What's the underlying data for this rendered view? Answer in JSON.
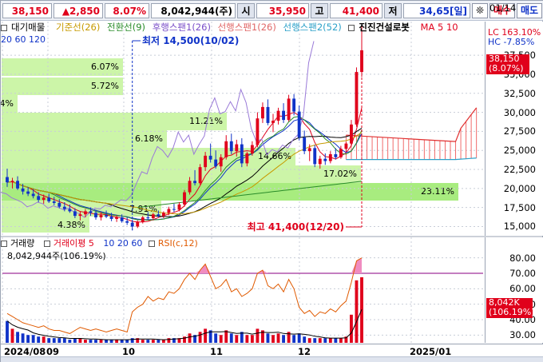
{
  "quote": {
    "price": "38,150",
    "change": "▲2,850",
    "change_pct": "8.07%",
    "volume": "8,042,944(주)",
    "open_label": "시",
    "open": "35,950",
    "high_label": "고",
    "high": "41,400",
    "low_label": "저",
    "low_value": "34,65[일]",
    "buy_label": "매수",
    "sell_label": "매도"
  },
  "legend": {
    "sections": "대기매물",
    "base_line": "기준선(26)",
    "conversion_line": "전환선(9)",
    "lagging_span": "후행스팬1(26)",
    "leading_span1": "선행스팬1(26)",
    "leading_span2": "선행스팬2(52)",
    "robot": "진진건설로봇",
    "ma_label": "MA 5  10",
    "ma_periods": "20  60  120"
  },
  "annotations": {
    "low_marker": "최저 14,500(10/02)",
    "high_marker": "최고 41,400(12/20)"
  },
  "supply_zones": [
    {
      "label": "6.07%"
    },
    {
      "label": "5.72%"
    },
    {
      "label": "0.94%"
    },
    {
      "label": "11.21%"
    },
    {
      "label": "6.18%"
    },
    {
      "label": "14.66%"
    },
    {
      "label": "17.02%"
    },
    {
      "label": "23.11%"
    },
    {
      "label": "7.91%"
    },
    {
      "label": "4.38%"
    }
  ],
  "price_axis": {
    "lc": "LC 163.10%",
    "hc": "HC  -7.85%",
    "current_price": "38,150",
    "current_pct": "(8.07%)",
    "ticks": [
      "37,500",
      "35,000",
      "32,500",
      "30,000",
      "27,500",
      "25,000",
      "22,500",
      "20,000",
      "17,500",
      "15,000"
    ]
  },
  "volume_panel": {
    "title": "거래량",
    "ma_label": "거래이평 5",
    "ma_periods": "10  20  60",
    "rsi_label": "RSI(c,12)",
    "value": "8,042,944주(106.19%)",
    "tag_value": "8,042K",
    "tag_pct": "(106.19%)",
    "ticks": [
      "80.00",
      "70.00",
      "60.00",
      "50.00",
      "40.00",
      "30.00"
    ]
  },
  "date_axis": {
    "labels": [
      "2024/08",
      "09",
      "10",
      "11",
      "12",
      "2025/01"
    ],
    "end": "01/14"
  },
  "colors": {
    "up": "#e0001b",
    "down": "#1033c8",
    "zone": "#ccf5a8",
    "zone_top": "#a8ec7f",
    "cloud": "#f06a6a",
    "rsi_fill": "#f08cc0"
  },
  "chart_data": {
    "type": "candlestick",
    "ylim": [
      14000,
      41500
    ],
    "dates_approx": "2024/08 - 2024/12/20",
    "series": [
      {
        "name": "MA 5",
        "values": []
      },
      {
        "name": "MA 10",
        "values": []
      },
      {
        "name": "MA 20",
        "values": []
      },
      {
        "name": "MA 60",
        "values": []
      },
      {
        "name": "MA 120",
        "values": []
      }
    ],
    "candles": [
      [
        21500,
        22600,
        20200,
        20800
      ],
      [
        20800,
        21400,
        20000,
        21000
      ],
      [
        21000,
        21600,
        19800,
        20000
      ],
      [
        20000,
        20600,
        19200,
        19600
      ],
      [
        19600,
        20200,
        19000,
        19300
      ],
      [
        19300,
        19900,
        18700,
        19000
      ],
      [
        19000,
        19500,
        18200,
        18500
      ],
      [
        18500,
        19200,
        18000,
        18800
      ],
      [
        18800,
        19300,
        18100,
        18300
      ],
      [
        18300,
        18900,
        17800,
        18100
      ],
      [
        18100,
        18600,
        17400,
        17600
      ],
      [
        17600,
        18200,
        17000,
        17300
      ],
      [
        17300,
        17900,
        16800,
        17000
      ],
      [
        17000,
        17400,
        16100,
        16400
      ],
      [
        16400,
        17000,
        15800,
        16600
      ],
      [
        16600,
        17300,
        16200,
        17000
      ],
      [
        17000,
        17500,
        16400,
        16800
      ],
      [
        16800,
        17200,
        15900,
        16200
      ],
      [
        16200,
        16900,
        15800,
        16500
      ],
      [
        16500,
        17100,
        16100,
        16300
      ],
      [
        16300,
        16800,
        15700,
        16000
      ],
      [
        16000,
        16500,
        15600,
        16200
      ],
      [
        16200,
        16600,
        15500,
        15700
      ],
      [
        15700,
        16200,
        15200,
        15500
      ],
      [
        15500,
        15900,
        14500,
        15000
      ],
      [
        15000,
        15800,
        14800,
        15600
      ],
      [
        15600,
        16400,
        15400,
        16200
      ],
      [
        16200,
        16900,
        15900,
        16100
      ],
      [
        16100,
        16800,
        15800,
        16600
      ],
      [
        16600,
        17100,
        16200,
        16400
      ],
      [
        16400,
        17000,
        16100,
        16800
      ],
      [
        16800,
        17600,
        16500,
        17300
      ],
      [
        17300,
        18000,
        16900,
        17200
      ],
      [
        17200,
        18200,
        17000,
        17900
      ],
      [
        17900,
        19800,
        17600,
        19500
      ],
      [
        19500,
        21500,
        19200,
        21000
      ],
      [
        21000,
        22400,
        20400,
        20700
      ],
      [
        20700,
        23200,
        20500,
        22800
      ],
      [
        22800,
        24800,
        22300,
        24300
      ],
      [
        24300,
        25900,
        23400,
        23800
      ],
      [
        23800,
        25000,
        22600,
        22900
      ],
      [
        22900,
        24500,
        22200,
        24100
      ],
      [
        24100,
        27000,
        23800,
        26200
      ],
      [
        26200,
        27200,
        24500,
        24900
      ],
      [
        24900,
        26400,
        24200,
        25800
      ],
      [
        25800,
        26600,
        22800,
        23300
      ],
      [
        23300,
        24800,
        22900,
        24600
      ],
      [
        24600,
        26200,
        24300,
        25700
      ],
      [
        25700,
        30000,
        25400,
        29200
      ],
      [
        29200,
        31300,
        28600,
        30700
      ],
      [
        30700,
        31700,
        28300,
        28600
      ],
      [
        28600,
        29800,
        27400,
        28900
      ],
      [
        28900,
        30600,
        28400,
        30200
      ],
      [
        30200,
        31200,
        28600,
        29000
      ],
      [
        29000,
        32300,
        28800,
        31800
      ],
      [
        31800,
        32400,
        29600,
        30100
      ],
      [
        30100,
        30900,
        26300,
        26700
      ],
      [
        26700,
        27600,
        24500,
        24900
      ],
      [
        24900,
        25800,
        23600,
        25300
      ],
      [
        25300,
        25700,
        22800,
        23200
      ],
      [
        23200,
        24300,
        22600,
        23900
      ],
      [
        23900,
        24600,
        23100,
        23600
      ],
      [
        23600,
        24900,
        23300,
        24500
      ],
      [
        24500,
        25300,
        23800,
        24100
      ],
      [
        24100,
        25600,
        23900,
        25200
      ],
      [
        25200,
        26100,
        24800,
        25900
      ],
      [
        25900,
        29000,
        25600,
        28400
      ],
      [
        28400,
        35900,
        28100,
        35300
      ],
      [
        35300,
        41400,
        34650,
        38150
      ]
    ],
    "volume": [
      14,
      9,
      7,
      6,
      5,
      5,
      4,
      4,
      3,
      3,
      3,
      3,
      2,
      3,
      3,
      2,
      2,
      2,
      2,
      2,
      2,
      2,
      2,
      2,
      3,
      3,
      2,
      2,
      2,
      2,
      2,
      3,
      3,
      3,
      4,
      6,
      5,
      7,
      9,
      8,
      6,
      5,
      8,
      6,
      5,
      7,
      5,
      5,
      9,
      8,
      6,
      5,
      6,
      5,
      7,
      5,
      6,
      4,
      3,
      3,
      3,
      3,
      3,
      3,
      3,
      4,
      18,
      40,
      42
    ],
    "rsi": [
      44,
      42,
      40,
      38,
      37,
      36,
      35,
      36,
      34,
      33,
      33,
      32,
      31,
      33,
      35,
      34,
      33,
      34,
      33,
      32,
      33,
      34,
      33,
      32,
      45,
      48,
      50,
      55,
      52,
      54,
      53,
      58,
      57,
      60,
      66,
      70,
      66,
      72,
      76,
      68,
      60,
      62,
      66,
      58,
      60,
      55,
      57,
      60,
      70,
      72,
      62,
      60,
      63,
      58,
      66,
      60,
      48,
      44,
      46,
      42,
      45,
      44,
      47,
      45,
      49,
      52,
      64,
      78,
      80
    ]
  }
}
